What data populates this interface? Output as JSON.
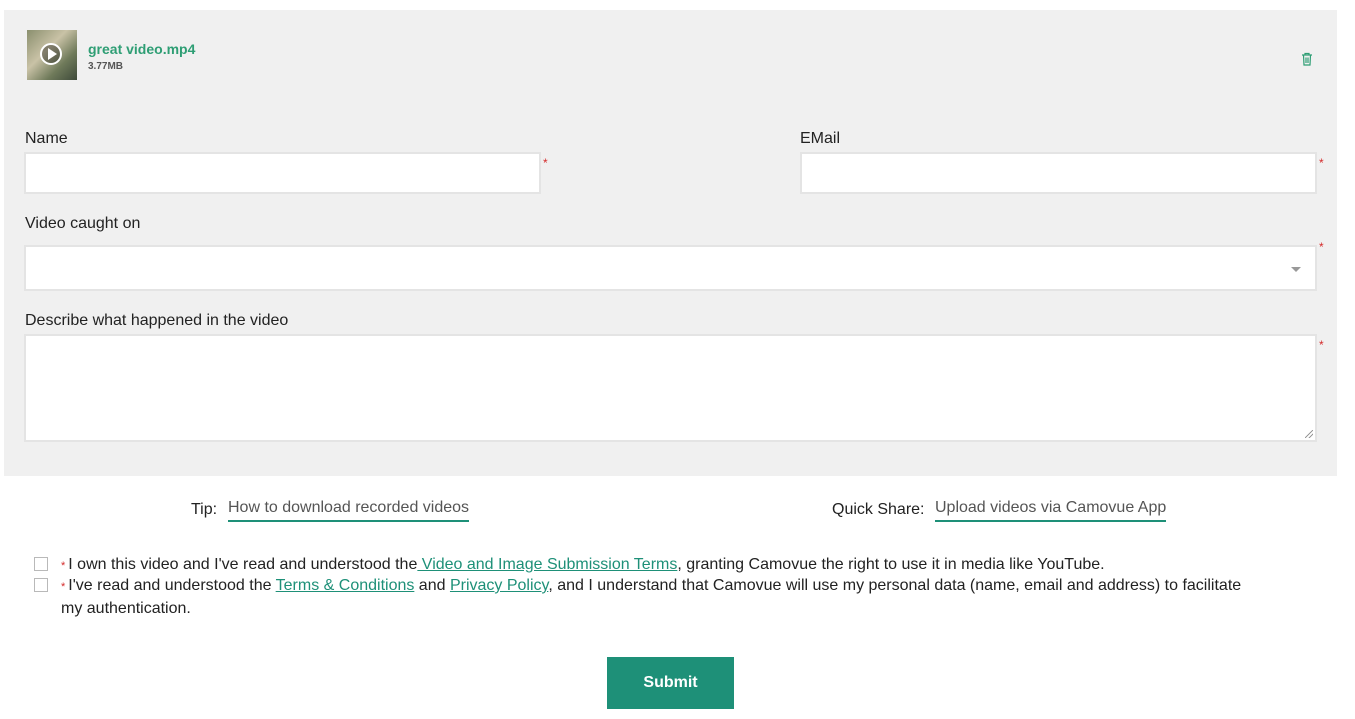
{
  "file": {
    "name": "great video.mp4",
    "size": "3.77MB",
    "thumbnail_icon": "play-icon",
    "delete_icon": "trash-icon"
  },
  "form": {
    "name_label": "Name",
    "email_label": "EMail",
    "caught_on_label": "Video caught on",
    "describe_label": "Describe what happened in the video",
    "required_mark": "*",
    "name_value": "",
    "email_value": "",
    "caught_on_value": "",
    "describe_value": ""
  },
  "tips": {
    "tip_label": "Tip:",
    "tip_link": "How to download recorded videos",
    "share_label": "Quick Share:",
    "share_link": "Upload videos via Camovue App"
  },
  "consent": {
    "first_prefix": "I own this video and I've read and understood the",
    "first_link": " Video and Image Submission Terms",
    "first_suffix": ", granting Camovue the right to use it in media like YouTube.",
    "second_prefix": "I've read and understood the ",
    "second_link_terms": "Terms & Conditions",
    "second_and": " and ",
    "second_link_privacy": "Privacy Policy",
    "second_suffix": ", and I understand that Camovue will use my personal data (name, email and address) to facilitate my authentication.",
    "required_mark": "*"
  },
  "submit_label": "Submit",
  "colors": {
    "accent": "#1e9078",
    "file_name": "#2e9e74",
    "required": "#d42a2a",
    "panel_bg": "#f0f0f0"
  }
}
